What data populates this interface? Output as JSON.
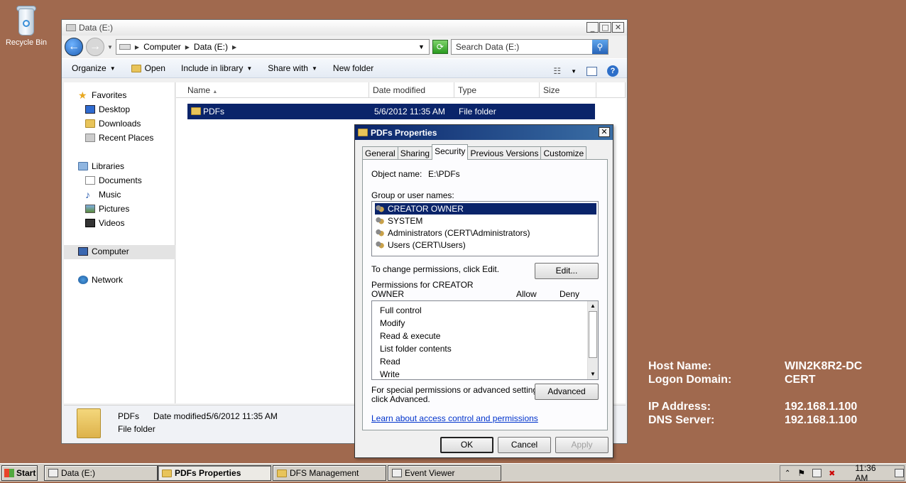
{
  "desktop": {
    "recycle_bin_label": "Recycle Bin"
  },
  "explorer": {
    "title": "Data (E:)",
    "breadcrumb": [
      "Computer",
      "Data (E:)"
    ],
    "search_placeholder": "Search Data (E:)",
    "toolbar": {
      "organize": "Organize",
      "open": "Open",
      "include": "Include in library",
      "share": "Share with",
      "new_folder": "New folder"
    },
    "nav": {
      "favorites": "Favorites",
      "desktop": "Desktop",
      "downloads": "Downloads",
      "recent": "Recent Places",
      "libraries": "Libraries",
      "documents": "Documents",
      "music": "Music",
      "pictures": "Pictures",
      "videos": "Videos",
      "computer": "Computer",
      "network": "Network"
    },
    "columns": {
      "name": "Name",
      "date": "Date modified",
      "type": "Type",
      "size": "Size"
    },
    "rows": [
      {
        "name": "PDFs",
        "date": "5/6/2012 11:35 AM",
        "type": "File folder"
      }
    ],
    "details": {
      "name": "PDFs",
      "date_label": "Date modified:",
      "date": "5/6/2012 11:35 AM",
      "type": "File folder"
    }
  },
  "dialog": {
    "title": "PDFs Properties",
    "tabs": [
      "General",
      "Sharing",
      "Security",
      "Previous Versions",
      "Customize"
    ],
    "object_name_label": "Object name:",
    "object_name": "E:\\PDFs",
    "group_label": "Group or user names:",
    "users": [
      "CREATOR OWNER",
      "SYSTEM",
      "Administrators (CERT\\Administrators)",
      "Users (CERT\\Users)"
    ],
    "change_text": "To change permissions, click Edit.",
    "edit_btn": "Edit...",
    "perm_for_line1": "Permissions for CREATOR",
    "perm_for_line2": "OWNER",
    "allow": "Allow",
    "deny": "Deny",
    "permissions": [
      "Full control",
      "Modify",
      "Read & execute",
      "List folder contents",
      "Read",
      "Write"
    ],
    "special_line1": "For special permissions or advanced settings,",
    "special_line2": "click Advanced.",
    "advanced_btn": "Advanced",
    "learn_link": "Learn about access control and permissions",
    "ok": "OK",
    "cancel": "Cancel",
    "apply": "Apply"
  },
  "info": {
    "host_label": "Host Name:",
    "host": "WIN2K8R2-DC",
    "domain_label": "Logon Domain:",
    "domain": "CERT",
    "ip_label": "IP Address:",
    "ip": "192.168.1.100",
    "dns_label": "DNS Server:",
    "dns": "192.168.1.100"
  },
  "taskbar": {
    "start": "Start",
    "tasks": [
      "Data (E:)",
      "PDFs Properties",
      "DFS Management",
      "Event Viewer"
    ],
    "clock": "11:36 AM"
  }
}
